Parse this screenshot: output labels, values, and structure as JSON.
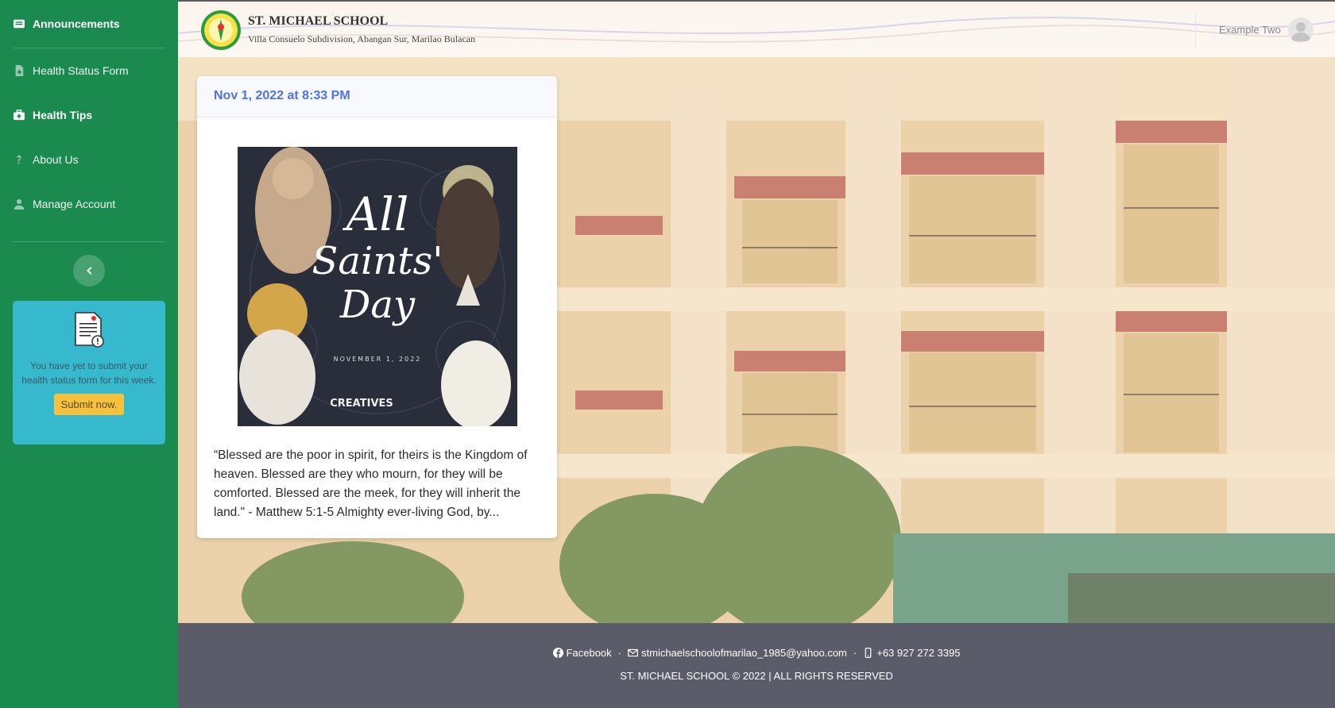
{
  "sidebar": {
    "items": [
      {
        "label": "Announcements",
        "icon": "announcement-icon"
      },
      {
        "label": "Health Status Form",
        "icon": "file-medical-icon"
      },
      {
        "label": "Health Tips",
        "icon": "first-aid-kit-icon"
      },
      {
        "label": "About Us",
        "icon": "question-icon"
      },
      {
        "label": "Manage Account",
        "icon": "user-icon"
      }
    ],
    "notice": {
      "text": "You have yet to submit your health status form for this week.",
      "button": "Submit now."
    }
  },
  "header": {
    "school_name": "ST. MICHAEL SCHOOL",
    "address": "Villa Consuelo Subdivision, Abangan Sur, Marilao Bulacan",
    "user_name": "Example Two"
  },
  "announcement": {
    "date": "Nov 1, 2022 at 8:33 PM",
    "poster": {
      "line1": "All",
      "line2": "Saints'",
      "line3": "Day",
      "date": "NOVEMBER 1, 2022",
      "credit": "CREATIVES"
    },
    "excerpt": "“Blessed are the poor in spirit, for theirs is the Kingdom of heaven. Blessed are they who mourn, for they will be comforted. Blessed are the meek, for they will inherit the land.\" - Matthew 5:1-5 Almighty ever-living God, by..."
  },
  "footer": {
    "facebook": "Facebook",
    "email": "stmichaelschoolofmarilao_1985@yahoo.com",
    "phone": "+63 927 272 3395",
    "separator": "·",
    "copyright": "ST. MICHAEL SCHOOL © 2022 | ALL RIGHTS RESERVED"
  },
  "colors": {
    "sidebar": "#1a8a4f",
    "notice": "#36b9cc",
    "notice_button": "#f6c23e",
    "card_title": "#4e73df",
    "footer": "#5a5c69"
  }
}
